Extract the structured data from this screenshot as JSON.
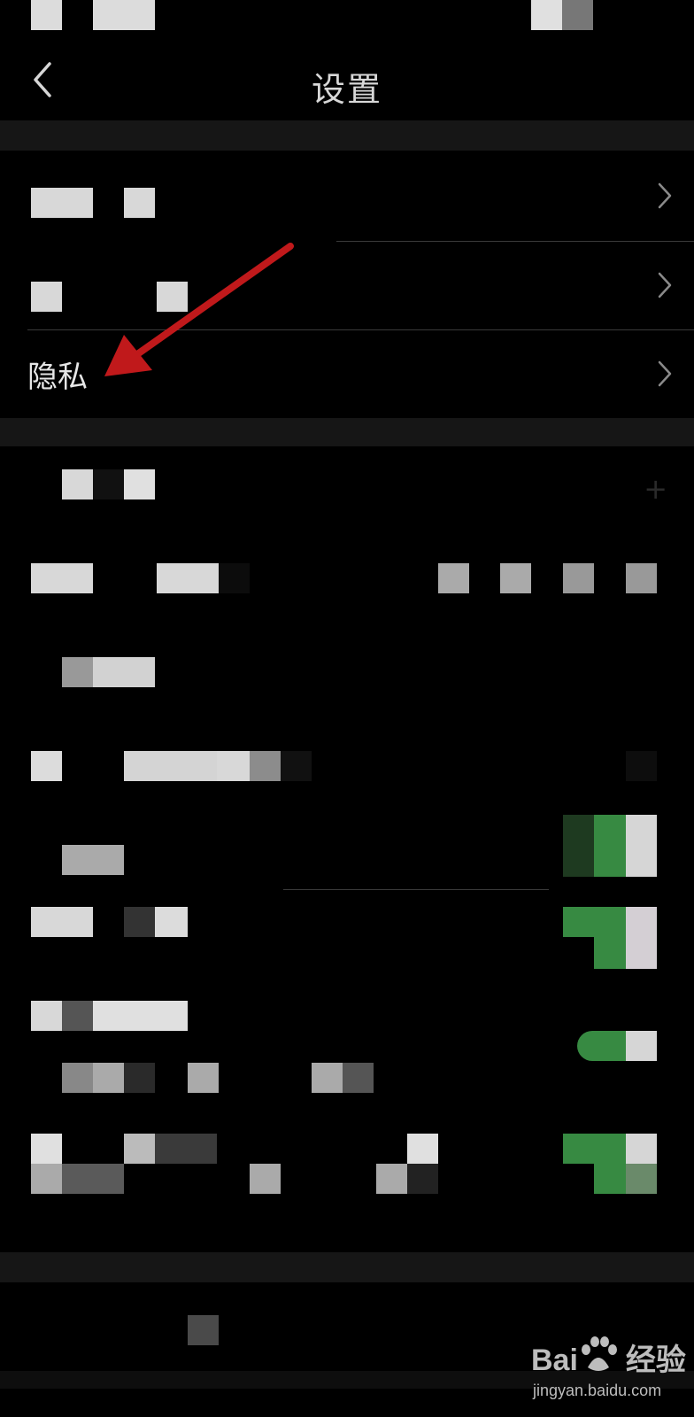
{
  "nav": {
    "title": "设置",
    "back_icon": "chevron-left-icon"
  },
  "settings": {
    "group1": [
      {
        "label": "",
        "obscured": true,
        "icon": "chevron-right-icon"
      },
      {
        "label": "",
        "obscured": true,
        "icon": "chevron-right-icon"
      },
      {
        "label": "隐私",
        "obscured": false,
        "icon": "chevron-right-icon"
      }
    ],
    "group2_obscured": true
  },
  "annotation": {
    "type": "arrow",
    "color": "#c0191b",
    "points_to": "隐私"
  },
  "watermark": {
    "brand": "Bai",
    "brand_suffix": "经验",
    "url": "jingyan.baidu.com"
  },
  "colors": {
    "background": "#000000",
    "group_gap": "#161616",
    "toggle_green": "#3a8a42",
    "text": "#e6e6e6"
  }
}
